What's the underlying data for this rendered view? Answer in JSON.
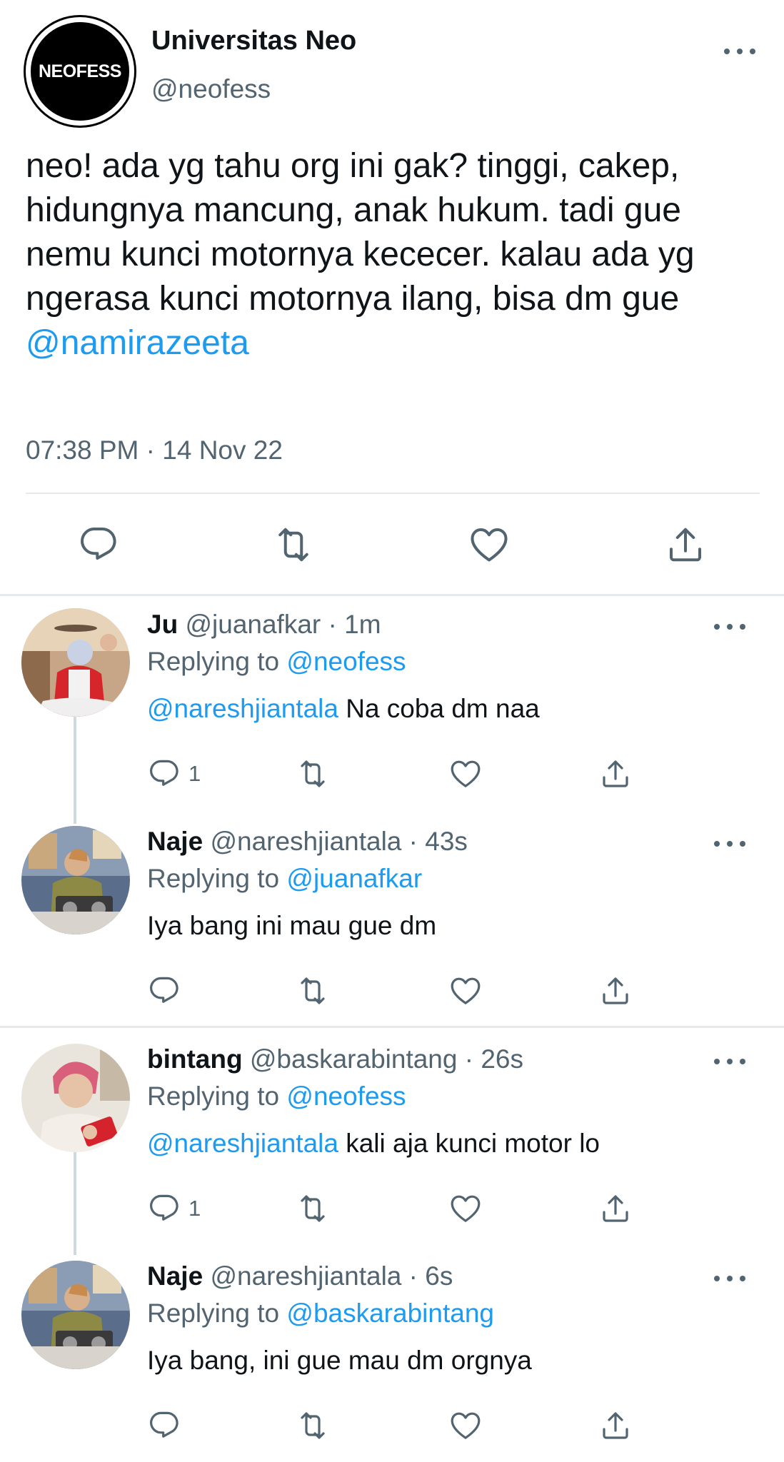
{
  "main_tweet": {
    "avatar_text": "NEOFESS",
    "name": "Universitas Neo",
    "handle": "@neofess",
    "text": "neo! ada yg tahu org ini gak? tinggi, cakep, hidungnya mancung, anak hukum. tadi gue nemu kunci motornya kececer. kalau ada yg ngerasa kunci motornya ilang, bisa dm gue ",
    "mention": "@namirazeeta",
    "time": "07:38 PM",
    "separator": " · ",
    "date": "14 Nov 22"
  },
  "replies": [
    {
      "name": "Ju",
      "handle": "@juanafkar",
      "age": " · 1m",
      "replying_label": "Replying to ",
      "replying_to": "@neofess",
      "mention": "@nareshjiantala",
      "text": " Na coba dm naa",
      "reply_count": "1"
    },
    {
      "name": "Naje",
      "handle": "@nareshjiantala",
      "age": " · 43s",
      "replying_label": "Replying to ",
      "replying_to": "@juanafkar",
      "text": "Iya bang ini mau gue dm"
    },
    {
      "name": "bintang",
      "handle": "@baskarabintang",
      "age": " · 26s",
      "replying_label": "Replying to ",
      "replying_to": "@neofess",
      "mention": "@nareshjiantala",
      "text": " kali aja kunci motor lo",
      "reply_count": "1"
    },
    {
      "name": "Naje",
      "handle": "@nareshjiantala",
      "age": " · 6s",
      "replying_label": "Replying to ",
      "replying_to": "@baskarabintang",
      "text": "Iya bang, ini gue mau dm orgnya"
    }
  ],
  "colors": {
    "text_primary": "#0f1419",
    "text_secondary": "#536471",
    "link": "#1d9bf0",
    "divider": "#e6e9ec",
    "thread_line": "#cfd9de"
  },
  "icons": [
    "reply-icon",
    "retweet-icon",
    "like-icon",
    "share-icon",
    "more-icon"
  ]
}
